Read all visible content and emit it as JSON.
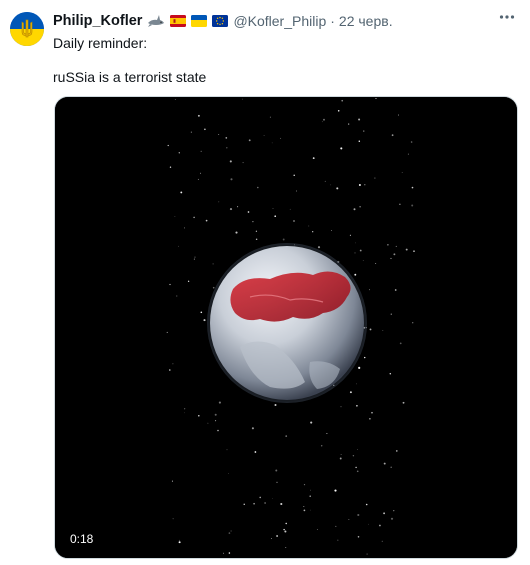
{
  "tweet": {
    "display_name": "Philip_Kofler",
    "handle": "@Kofler_Philip",
    "separator": "·",
    "time": "22 черв.",
    "text_line1": "Daily reminder:",
    "text_line2": "ruSSia is a terrorist state",
    "badges": [
      "shark-icon",
      "spain-flag-icon",
      "ukraine-flag-icon",
      "eu-flag-icon"
    ]
  },
  "video": {
    "duration": "0:18"
  },
  "colors": {
    "secondary_text": "#536471",
    "primary_text": "#0f1419",
    "ukraine_blue": "#0057b7",
    "ukraine_yellow": "#ffd700"
  }
}
